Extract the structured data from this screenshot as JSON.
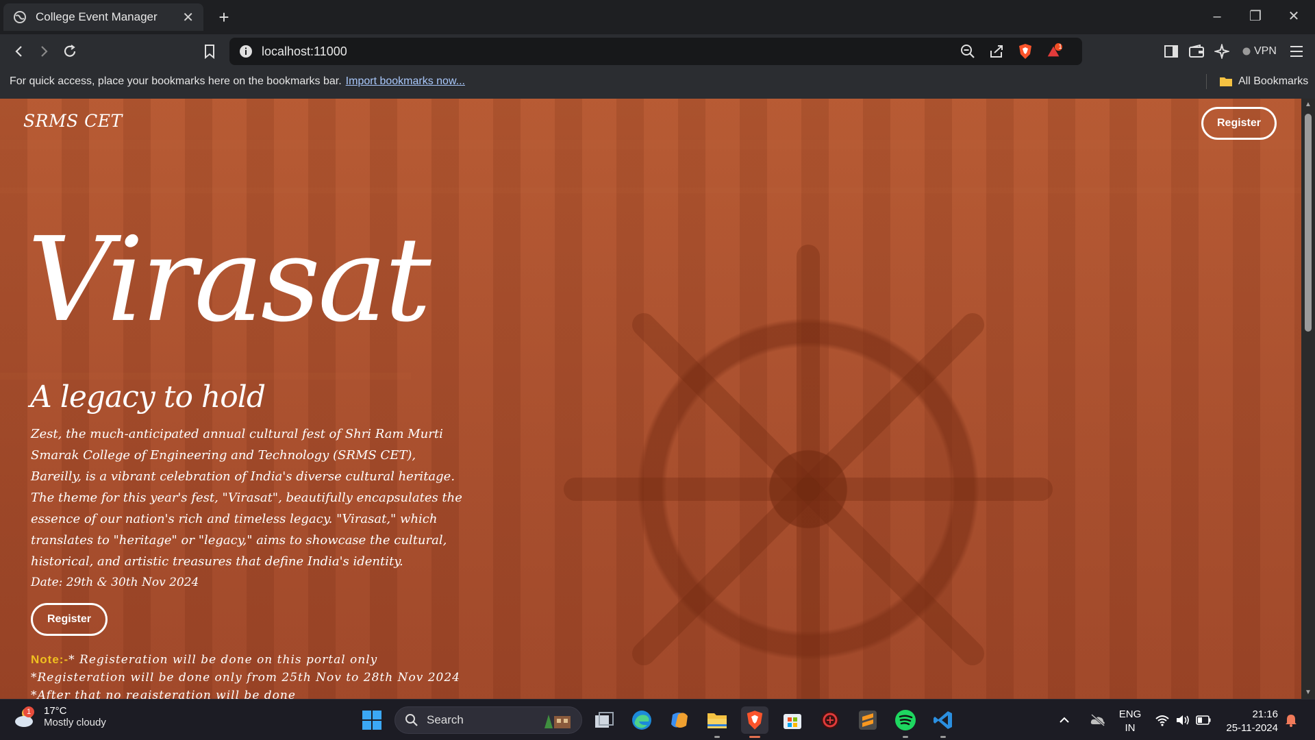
{
  "browser": {
    "tab_title": "College Event Manager",
    "tab_close": "✕",
    "new_tab": "+",
    "url": "localhost:11000",
    "vpn_label": "VPN",
    "brave_badge": "1",
    "bookmarks_prompt": "For quick access, place your bookmarks here on the bookmarks bar.",
    "bookmarks_import": "Import bookmarks now...",
    "all_bookmarks": "All Bookmarks"
  },
  "page": {
    "logo": "SRMS CET",
    "register_top": "Register",
    "title": "Virasat",
    "subtitle": "A legacy to hold",
    "description": "Zest, the much-anticipated annual cultural fest of Shri Ram Murti Smarak College of Engineering and Technology (SRMS CET), Bareilly, is a vibrant celebration of India's diverse cultural heritage. The theme for this year's fest, \"Virasat\", beautifully encapsulates the essence of our nation's rich and timeless legacy. \"Virasat,\" which translates to \"heritage\" or \"legacy,\" aims to showcase the cultural, historical, and artistic treasures that define India's identity.",
    "date": "Date: 29th & 30th Nov 2024",
    "register_main": "Register",
    "note_label": "Note:-",
    "note_1": "* Registeration will be done on this portal only",
    "note_2": "*Registeration will be done only from 25th Nov to 28th Nov 2024",
    "note_3": "*After that no registeration will be done"
  },
  "taskbar": {
    "temperature": "17°C",
    "weather": "Mostly cloudy",
    "weather_badge": "1",
    "search_label": "Search",
    "lang_1": "ENG",
    "lang_2": "IN",
    "time": "21:16",
    "date": "25-11-2024"
  },
  "colors": {
    "note_accent": "#f0c020",
    "page_bg": "#ad5330"
  }
}
